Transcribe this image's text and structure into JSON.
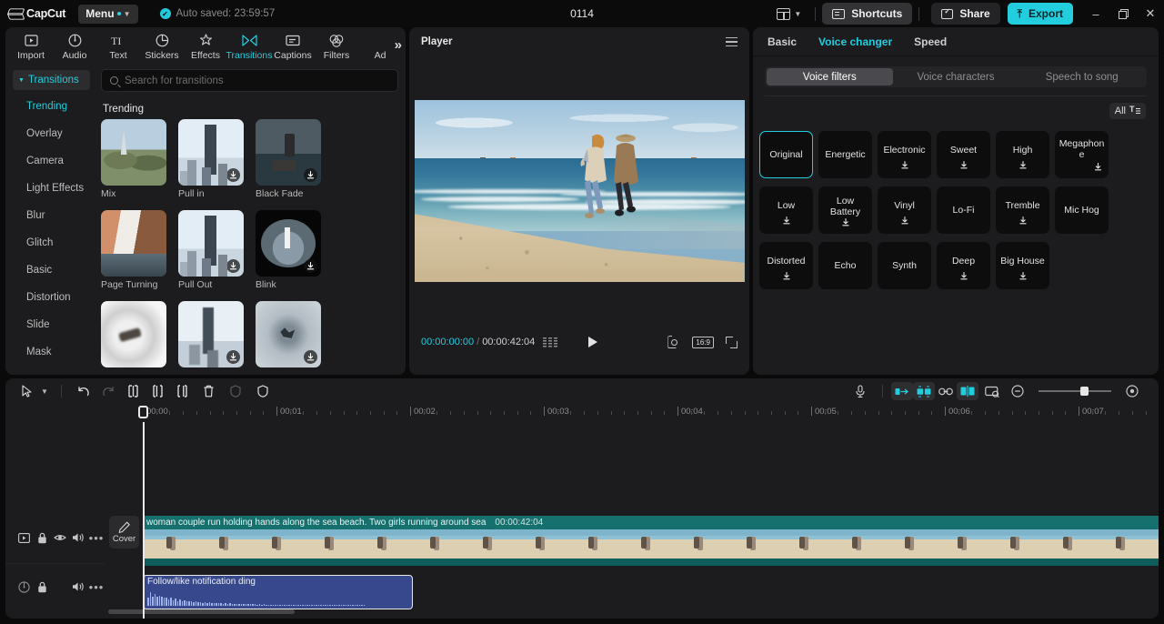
{
  "titlebar": {
    "brand": "CapCut",
    "menu_label": "Menu",
    "autosave_text": "Auto saved: 23:59:57",
    "doc_title": "0114",
    "shortcuts_label": "Shortcuts",
    "share_label": "Share",
    "export_label": "Export",
    "minimize": "–",
    "maximize": "❐",
    "close": "✕",
    "accent": "#22cddd"
  },
  "toolbar": {
    "tabs": [
      {
        "label": "Import",
        "icon": "import-icon",
        "active": false
      },
      {
        "label": "Audio",
        "icon": "audio-icon",
        "active": false
      },
      {
        "label": "Text",
        "icon": "text-icon",
        "active": false
      },
      {
        "label": "Stickers",
        "icon": "stickers-icon",
        "active": false
      },
      {
        "label": "Effects",
        "icon": "effects-icon",
        "active": false
      },
      {
        "label": "Transitions",
        "icon": "transitions-icon",
        "active": true
      },
      {
        "label": "Captions",
        "icon": "captions-icon",
        "active": false
      },
      {
        "label": "Filters",
        "icon": "filters-icon",
        "active": false
      },
      {
        "label": "Ad",
        "icon": "ad-icon",
        "active": false
      }
    ],
    "more_label": "»"
  },
  "library": {
    "category_header": "Transitions",
    "categories": [
      {
        "label": "Trending",
        "active": true
      },
      {
        "label": "Overlay",
        "active": false
      },
      {
        "label": "Camera",
        "active": false
      },
      {
        "label": "Light Effects",
        "active": false
      },
      {
        "label": "Blur",
        "active": false
      },
      {
        "label": "Glitch",
        "active": false
      },
      {
        "label": "Basic",
        "active": false
      },
      {
        "label": "Distortion",
        "active": false
      },
      {
        "label": "Slide",
        "active": false
      },
      {
        "label": "Mask",
        "active": false
      }
    ],
    "search_placeholder": "Search for transitions",
    "search_value": "",
    "section_title": "Trending",
    "items": [
      {
        "label": "Mix",
        "art": "art-mix",
        "download": false
      },
      {
        "label": "Pull in",
        "art": "art-city",
        "download": true
      },
      {
        "label": "Black Fade",
        "art": "art-dark",
        "download": true
      },
      {
        "label": "Page Turning",
        "art": "art-page",
        "download": true
      },
      {
        "label": "Pull Out",
        "art": "art-city",
        "download": true
      },
      {
        "label": "Blink",
        "art": "art-blink",
        "download": true
      },
      {
        "label": "",
        "art": "art-blur1",
        "download": false
      },
      {
        "label": "",
        "art": "art-blur2",
        "download": true
      },
      {
        "label": "",
        "art": "art-shatter",
        "download": true
      }
    ]
  },
  "player": {
    "title": "Player",
    "current_time": "00:00:00:00",
    "time_separator": "/",
    "total_time": "00:00:42:04",
    "aspect_ratio": "16:9",
    "play_icon": "play-icon",
    "crop_icon": "crop-icon",
    "fullscreen_icon": "fullscreen-icon"
  },
  "inspector": {
    "tabs": [
      {
        "label": "Basic",
        "active": false
      },
      {
        "label": "Voice changer",
        "active": true
      },
      {
        "label": "Speed",
        "active": false
      }
    ],
    "segments": [
      {
        "label": "Voice filters",
        "active": true
      },
      {
        "label": "Voice characters",
        "active": false
      },
      {
        "label": "Speech to song",
        "active": false
      }
    ],
    "filter_label": "All",
    "voice_filters": [
      {
        "label": "Original",
        "selected": true,
        "download": false
      },
      {
        "label": "Energetic",
        "selected": false,
        "download": false
      },
      {
        "label": "Electronic",
        "selected": false,
        "download": true
      },
      {
        "label": "Sweet",
        "selected": false,
        "download": true
      },
      {
        "label": "High",
        "selected": false,
        "download": true
      },
      {
        "label": "Megaphone",
        "selected": false,
        "download": true
      },
      {
        "label": "Low",
        "selected": false,
        "download": true
      },
      {
        "label": "Low Battery",
        "selected": false,
        "download": true
      },
      {
        "label": "Vinyl",
        "selected": false,
        "download": true
      },
      {
        "label": "Lo-Fi",
        "selected": false,
        "download": false
      },
      {
        "label": "Tremble",
        "selected": false,
        "download": true
      },
      {
        "label": "Mic Hog",
        "selected": false,
        "download": false
      },
      {
        "label": "Distorted",
        "selected": false,
        "download": true
      },
      {
        "label": "Echo",
        "selected": false,
        "download": false
      },
      {
        "label": "Synth",
        "selected": false,
        "download": false
      },
      {
        "label": "Deep",
        "selected": false,
        "download": true
      },
      {
        "label": "Big House",
        "selected": false,
        "download": true
      }
    ]
  },
  "timeline": {
    "tools": [
      {
        "name": "select-tool",
        "icon": "cursor-icon"
      },
      {
        "name": "select-dropdown",
        "icon": "chevron-down-icon"
      },
      {
        "name": "undo-button",
        "icon": "undo-icon"
      },
      {
        "name": "redo-button",
        "icon": "redo-icon"
      },
      {
        "name": "split-button",
        "icon": "split-icon"
      },
      {
        "name": "trim-left-button",
        "icon": "trim-left-icon"
      },
      {
        "name": "trim-right-button",
        "icon": "trim-right-icon"
      },
      {
        "name": "delete-button",
        "icon": "trash-icon"
      },
      {
        "name": "freeze-button",
        "icon": "freeze-icon"
      },
      {
        "name": "mask-button",
        "icon": "shield-icon"
      }
    ],
    "right_tools": [
      {
        "name": "record-voiceover-button",
        "icon": "mic-icon",
        "active": false
      },
      {
        "name": "auto-fill-button",
        "icon": "autofill-icon",
        "active": true
      },
      {
        "name": "mirror-button",
        "icon": "mirror-icon",
        "active": true
      },
      {
        "name": "link-button",
        "icon": "link-icon",
        "active": false
      },
      {
        "name": "split-view-button",
        "icon": "splitview-icon",
        "active": true
      },
      {
        "name": "preview-button",
        "icon": "preview-icon",
        "active": false
      }
    ],
    "zoom_out_label": "−",
    "zoom_in_label": "+",
    "ruler_labels": [
      "00:00",
      "00:01",
      "00:02",
      "00:03",
      "00:04",
      "00:05",
      "00:06",
      "00:07"
    ],
    "cover_label": "Cover",
    "video_track": {
      "title": "woman couple run holding hands along the sea beach. Two girls running around sea",
      "duration": "00:00:42:04",
      "header_icons": [
        "clip-icon",
        "lock-icon",
        "eye-icon",
        "volume-icon",
        "more-icon"
      ]
    },
    "audio_track": {
      "title": "Follow/like notification ding",
      "header_icons": [
        "audio-icon",
        "lock-icon",
        "volume-icon",
        "more-icon"
      ]
    }
  }
}
